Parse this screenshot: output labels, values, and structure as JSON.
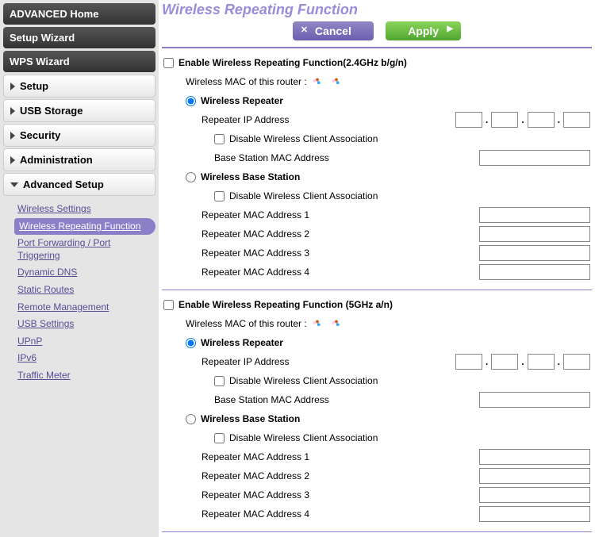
{
  "sidebar": {
    "home": "ADVANCED Home",
    "setup_wizard": "Setup Wizard",
    "wps_wizard": "WPS Wizard",
    "cats": {
      "setup": "Setup",
      "usb": "USB Storage",
      "security": "Security",
      "admin": "Administration",
      "adv": "Advanced Setup"
    },
    "adv_items": [
      "Wireless Settings",
      "Wireless Repeating Function",
      "Port Forwarding / Port Triggering",
      "Dynamic DNS",
      "Static Routes",
      "Remote Management",
      "USB Settings",
      "UPnP",
      "IPv6",
      "Traffic Meter"
    ]
  },
  "page": {
    "title": "Wireless Repeating Function",
    "cancel": "Cancel",
    "apply": "Apply"
  },
  "band24": {
    "enable_label": "Enable Wireless Repeating Function(2.4GHz b/g/n)",
    "mac_label": "Wireless MAC of this router :",
    "repeater_label": "Wireless Repeater",
    "repeater_ip_label": "Repeater IP Address",
    "disable_assoc_label": "Disable Wireless Client Association",
    "base_mac_label": "Base Station MAC Address",
    "base_label": "Wireless Base Station",
    "rmac1": "Repeater MAC Address 1",
    "rmac2": "Repeater MAC Address 2",
    "rmac3": "Repeater MAC Address 3",
    "rmac4": "Repeater MAC Address 4"
  },
  "band5": {
    "enable_label": "Enable Wireless Repeating Function (5GHz a/n)",
    "mac_label": "Wireless MAC of this router :",
    "repeater_label": "Wireless Repeater",
    "repeater_ip_label": "Repeater IP Address",
    "disable_assoc_label": "Disable Wireless Client Association",
    "base_mac_label": "Base Station MAC Address",
    "base_label": "Wireless Base Station",
    "rmac1": "Repeater MAC Address 1",
    "rmac2": "Repeater MAC Address 2",
    "rmac3": "Repeater MAC Address 3",
    "rmac4": "Repeater MAC Address 4"
  }
}
